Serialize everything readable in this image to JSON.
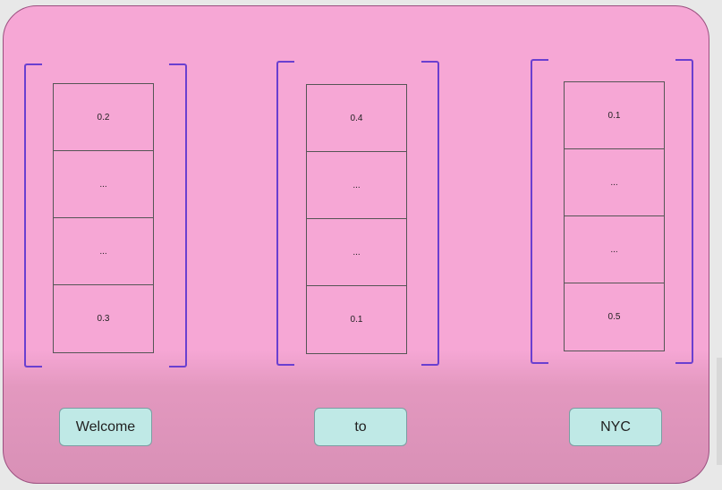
{
  "vectors": [
    {
      "word": "Welcome",
      "cells": [
        "0.2",
        "...",
        "...",
        "0.3"
      ]
    },
    {
      "word": "to",
      "cells": [
        "0.4",
        "...",
        "...",
        "0.1"
      ]
    },
    {
      "word": "NYC",
      "cells": [
        "0.1",
        "...",
        "...",
        "0.5"
      ]
    }
  ],
  "colors": {
    "panel": "#f6a7d5",
    "bracket": "#6a3fd0",
    "word_box": "#bfe9e6"
  }
}
